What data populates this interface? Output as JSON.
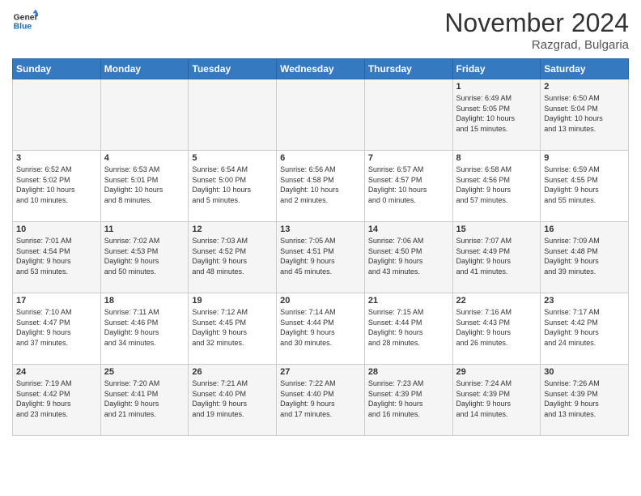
{
  "header": {
    "logo_line1": "General",
    "logo_line2": "Blue",
    "month": "November 2024",
    "location": "Razgrad, Bulgaria"
  },
  "weekdays": [
    "Sunday",
    "Monday",
    "Tuesday",
    "Wednesday",
    "Thursday",
    "Friday",
    "Saturday"
  ],
  "weeks": [
    [
      {
        "day": "",
        "info": ""
      },
      {
        "day": "",
        "info": ""
      },
      {
        "day": "",
        "info": ""
      },
      {
        "day": "",
        "info": ""
      },
      {
        "day": "",
        "info": ""
      },
      {
        "day": "1",
        "info": "Sunrise: 6:49 AM\nSunset: 5:05 PM\nDaylight: 10 hours\nand 15 minutes."
      },
      {
        "day": "2",
        "info": "Sunrise: 6:50 AM\nSunset: 5:04 PM\nDaylight: 10 hours\nand 13 minutes."
      }
    ],
    [
      {
        "day": "3",
        "info": "Sunrise: 6:52 AM\nSunset: 5:02 PM\nDaylight: 10 hours\nand 10 minutes."
      },
      {
        "day": "4",
        "info": "Sunrise: 6:53 AM\nSunset: 5:01 PM\nDaylight: 10 hours\nand 8 minutes."
      },
      {
        "day": "5",
        "info": "Sunrise: 6:54 AM\nSunset: 5:00 PM\nDaylight: 10 hours\nand 5 minutes."
      },
      {
        "day": "6",
        "info": "Sunrise: 6:56 AM\nSunset: 4:58 PM\nDaylight: 10 hours\nand 2 minutes."
      },
      {
        "day": "7",
        "info": "Sunrise: 6:57 AM\nSunset: 4:57 PM\nDaylight: 10 hours\nand 0 minutes."
      },
      {
        "day": "8",
        "info": "Sunrise: 6:58 AM\nSunset: 4:56 PM\nDaylight: 9 hours\nand 57 minutes."
      },
      {
        "day": "9",
        "info": "Sunrise: 6:59 AM\nSunset: 4:55 PM\nDaylight: 9 hours\nand 55 minutes."
      }
    ],
    [
      {
        "day": "10",
        "info": "Sunrise: 7:01 AM\nSunset: 4:54 PM\nDaylight: 9 hours\nand 53 minutes."
      },
      {
        "day": "11",
        "info": "Sunrise: 7:02 AM\nSunset: 4:53 PM\nDaylight: 9 hours\nand 50 minutes."
      },
      {
        "day": "12",
        "info": "Sunrise: 7:03 AM\nSunset: 4:52 PM\nDaylight: 9 hours\nand 48 minutes."
      },
      {
        "day": "13",
        "info": "Sunrise: 7:05 AM\nSunset: 4:51 PM\nDaylight: 9 hours\nand 45 minutes."
      },
      {
        "day": "14",
        "info": "Sunrise: 7:06 AM\nSunset: 4:50 PM\nDaylight: 9 hours\nand 43 minutes."
      },
      {
        "day": "15",
        "info": "Sunrise: 7:07 AM\nSunset: 4:49 PM\nDaylight: 9 hours\nand 41 minutes."
      },
      {
        "day": "16",
        "info": "Sunrise: 7:09 AM\nSunset: 4:48 PM\nDaylight: 9 hours\nand 39 minutes."
      }
    ],
    [
      {
        "day": "17",
        "info": "Sunrise: 7:10 AM\nSunset: 4:47 PM\nDaylight: 9 hours\nand 37 minutes."
      },
      {
        "day": "18",
        "info": "Sunrise: 7:11 AM\nSunset: 4:46 PM\nDaylight: 9 hours\nand 34 minutes."
      },
      {
        "day": "19",
        "info": "Sunrise: 7:12 AM\nSunset: 4:45 PM\nDaylight: 9 hours\nand 32 minutes."
      },
      {
        "day": "20",
        "info": "Sunrise: 7:14 AM\nSunset: 4:44 PM\nDaylight: 9 hours\nand 30 minutes."
      },
      {
        "day": "21",
        "info": "Sunrise: 7:15 AM\nSunset: 4:44 PM\nDaylight: 9 hours\nand 28 minutes."
      },
      {
        "day": "22",
        "info": "Sunrise: 7:16 AM\nSunset: 4:43 PM\nDaylight: 9 hours\nand 26 minutes."
      },
      {
        "day": "23",
        "info": "Sunrise: 7:17 AM\nSunset: 4:42 PM\nDaylight: 9 hours\nand 24 minutes."
      }
    ],
    [
      {
        "day": "24",
        "info": "Sunrise: 7:19 AM\nSunset: 4:42 PM\nDaylight: 9 hours\nand 23 minutes."
      },
      {
        "day": "25",
        "info": "Sunrise: 7:20 AM\nSunset: 4:41 PM\nDaylight: 9 hours\nand 21 minutes."
      },
      {
        "day": "26",
        "info": "Sunrise: 7:21 AM\nSunset: 4:40 PM\nDaylight: 9 hours\nand 19 minutes."
      },
      {
        "day": "27",
        "info": "Sunrise: 7:22 AM\nSunset: 4:40 PM\nDaylight: 9 hours\nand 17 minutes."
      },
      {
        "day": "28",
        "info": "Sunrise: 7:23 AM\nSunset: 4:39 PM\nDaylight: 9 hours\nand 16 minutes."
      },
      {
        "day": "29",
        "info": "Sunrise: 7:24 AM\nSunset: 4:39 PM\nDaylight: 9 hours\nand 14 minutes."
      },
      {
        "day": "30",
        "info": "Sunrise: 7:26 AM\nSunset: 4:39 PM\nDaylight: 9 hours\nand 13 minutes."
      }
    ]
  ]
}
